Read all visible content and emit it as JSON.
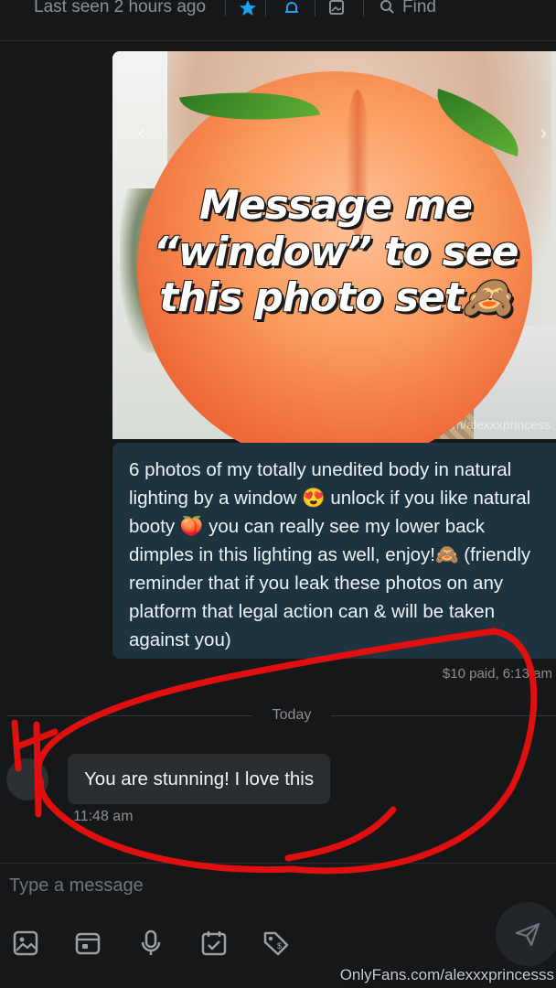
{
  "header": {
    "last_seen": "Last seen 2 hours ago",
    "find_label": "Find",
    "accent_color": "#1da1f2",
    "icons": [
      "star-icon",
      "bell-icon",
      "image-icon",
      "search-icon"
    ]
  },
  "media": {
    "overlay_text": "Message me “window” to see this photo set🙈",
    "watermark": "ns.com/alexxxprincess",
    "prev_glyph": "‹",
    "next_glyph": "›"
  },
  "message": {
    "caption": "6 photos of my totally unedited body in natural lighting by a window 😍 unlock if you like natural booty 🍑 you can really see my lower back dimples in this lighting as well, enjoy!🙈 (friendly reminder that if you leak these photos on any platform that legal action can & will be taken against you)",
    "meta": "$10 paid, 6:13 am"
  },
  "divider": {
    "label": "Today"
  },
  "incoming": {
    "text": "You are stunning! I love this",
    "time": "11:48 am"
  },
  "composer": {
    "placeholder": "Type a message",
    "tools": [
      "image-icon",
      "vault-icon",
      "microphone-icon",
      "calendar-icon",
      "price-tag-icon"
    ],
    "send_icon": "send-icon"
  },
  "footer": {
    "watermark": "OnlyFans.com/alexxxprincesss"
  },
  "annotation_color": "#e01010"
}
